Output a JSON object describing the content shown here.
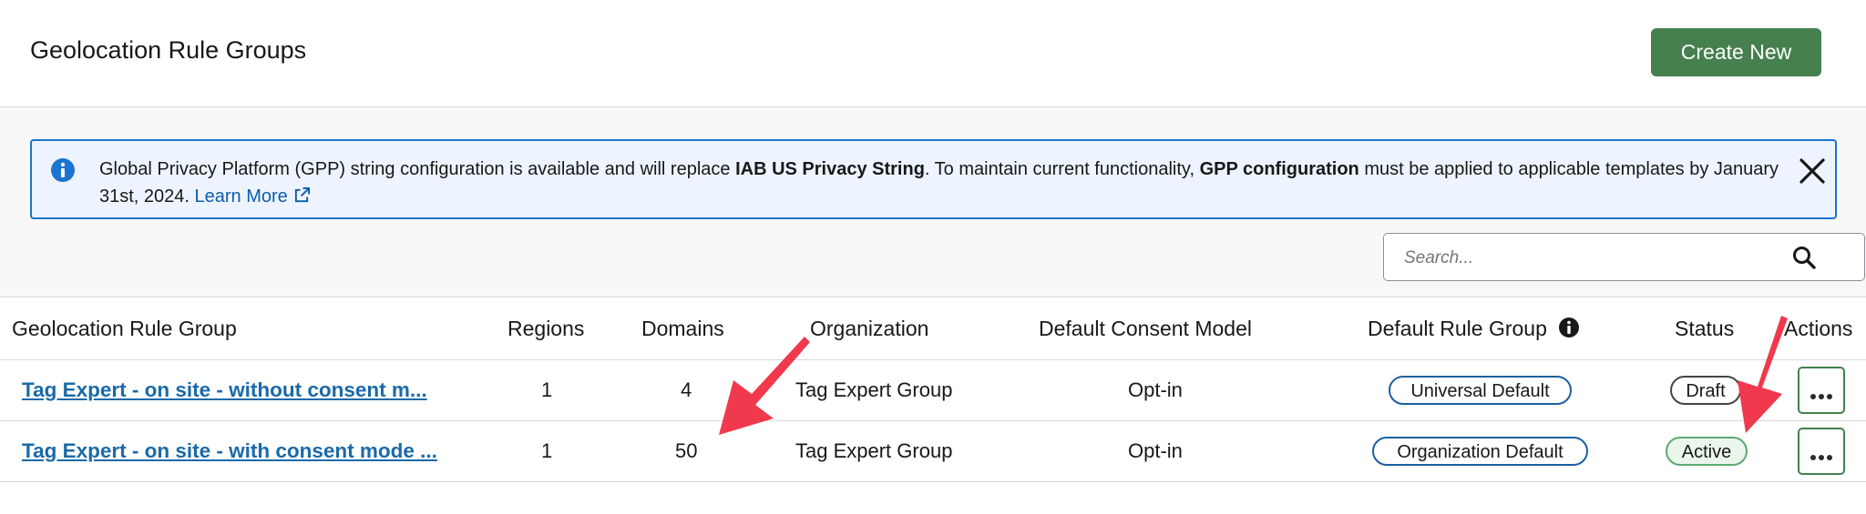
{
  "header": {
    "title": "Geolocation Rule Groups",
    "create_button": "Create New"
  },
  "banner": {
    "text_1": "Global Privacy Platform (GPP) string configuration is available and will replace ",
    "bold_1": "IAB US Privacy String",
    "text_2": ". To maintain current functionality, ",
    "bold_2": "GPP configuration",
    "text_3": " must be applied to applicable templates by January 31st, 2024. ",
    "link": "Learn More"
  },
  "search": {
    "placeholder": "Search..."
  },
  "table": {
    "columns": [
      "Geolocation Rule Group",
      "Regions",
      "Domains",
      "Organization",
      "Default Consent Model",
      "Default Rule Group",
      "Status",
      "Actions"
    ],
    "rows": [
      {
        "name": "Tag Expert - on site - without consent m...",
        "regions": "1",
        "domains": "4",
        "organization": "Tag Expert Group",
        "consent_model": "Opt-in",
        "default_rule_group": "Universal Default",
        "status": "Draft"
      },
      {
        "name": "Tag Expert - on site - with consent mode ...",
        "regions": "1",
        "domains": "50",
        "organization": "Tag Expert Group",
        "consent_model": "Opt-in",
        "default_rule_group": "Organization Default",
        "status": "Active"
      }
    ]
  },
  "colors": {
    "primary_button": "#45804e",
    "banner_border": "#1b74d0",
    "banner_bg": "#eef4ff",
    "link": "#1a6aa8",
    "annotation_arrow": "#f0394d"
  },
  "icons": {
    "info": "info-icon",
    "close": "close-icon",
    "search": "search-icon",
    "external_link": "external-link-icon",
    "actions": "more-icon"
  }
}
